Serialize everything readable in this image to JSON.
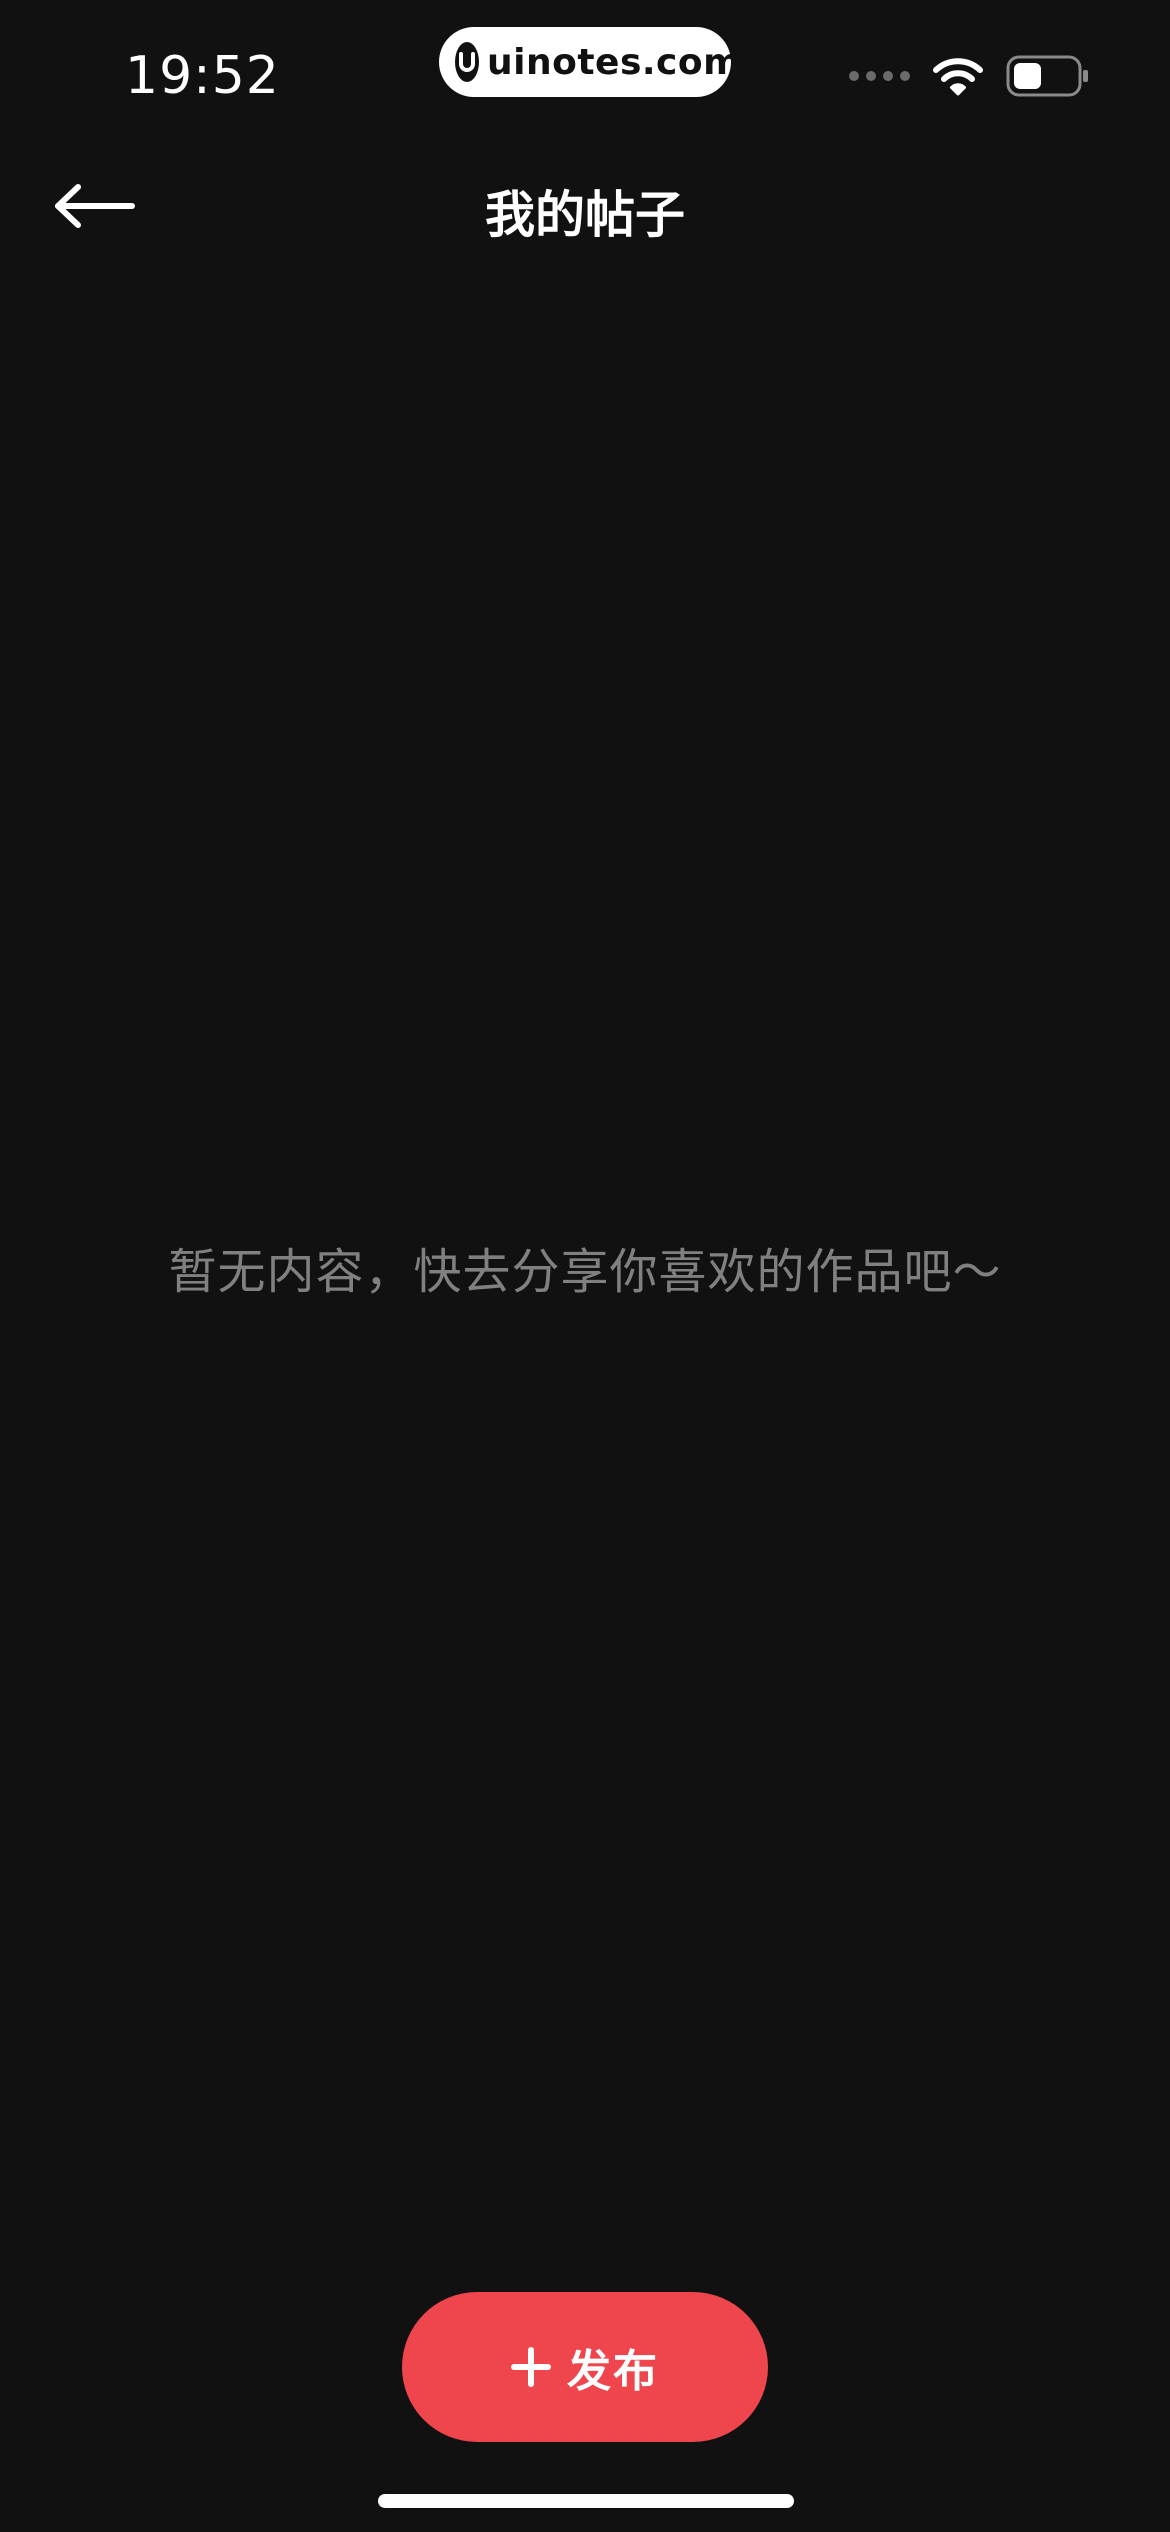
{
  "status_bar": {
    "time": "19:52",
    "watermark": "uinotes.com",
    "signal_icon": "signal-dots-icon",
    "wifi_icon": "wifi-icon",
    "battery_icon": "battery-icon",
    "battery_level": 0.45
  },
  "nav": {
    "back_icon": "arrow-left-icon",
    "title": "我的帖子"
  },
  "empty_state": {
    "message": "暂无内容，快去分享你喜欢的作品吧～"
  },
  "publish": {
    "icon": "plus-icon",
    "label": "发布",
    "color": "#ee464c"
  },
  "colors": {
    "background": "#111111",
    "accent": "#ee464c",
    "muted_text": "#808080"
  }
}
